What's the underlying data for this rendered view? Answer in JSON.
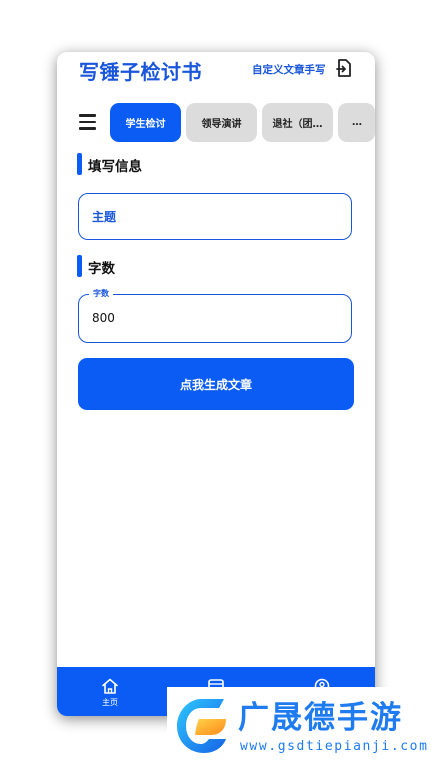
{
  "header": {
    "title": "写锤子检讨书",
    "custom_link": "自定义文章手写",
    "export_icon": "export-file-icon"
  },
  "tabs": [
    {
      "label": "学生检讨",
      "active": true
    },
    {
      "label": "领导演讲",
      "active": false
    },
    {
      "label": "退社（团…",
      "active": false
    },
    {
      "label": "…",
      "active": false
    }
  ],
  "form": {
    "info_section_label": "填写信息",
    "topic_placeholder": "主题",
    "wordcount_section_label": "字数",
    "wordcount_field_label": "字数",
    "wordcount_value": "800",
    "generate_label": "点我生成文章"
  },
  "bottom_nav": [
    {
      "label": "主页",
      "icon": "home-icon"
    },
    {
      "label": "",
      "icon": "list-icon"
    },
    {
      "label": "",
      "icon": "profile-icon"
    }
  ],
  "watermark": {
    "brand": "广晟德手游",
    "url": "www.gsdtiepianji.com"
  },
  "colors": {
    "accent": "#0a5cf5",
    "title": "#1a56db",
    "tab_inactive": "#dcdcdc",
    "watermark": "#1e7bf0"
  }
}
